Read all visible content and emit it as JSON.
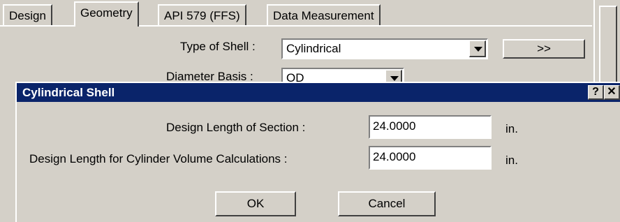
{
  "tabs": [
    {
      "label": "Design"
    },
    {
      "label": "Geometry"
    },
    {
      "label": "API 579 (FFS)"
    },
    {
      "label": "Data Measurement"
    }
  ],
  "form": {
    "type_of_shell_label": "Type of Shell :",
    "type_of_shell_value": "Cylindrical",
    "more_button_label": ">>",
    "diameter_basis_label": "Diameter Basis :",
    "diameter_basis_value": "OD"
  },
  "dialog": {
    "title": "Cylindrical Shell",
    "help_label": "?",
    "close_label": "✕",
    "fields": [
      {
        "label": "Design Length of Section :",
        "value": "24.0000",
        "unit": "in."
      },
      {
        "label": "Design Length for Cylinder Volume Calculations :",
        "value": "24.0000",
        "unit": "in."
      }
    ],
    "ok_label": "OK",
    "cancel_label": "Cancel"
  },
  "colors": {
    "face": "#d4d0c8",
    "titlebar": "#0a246a"
  }
}
